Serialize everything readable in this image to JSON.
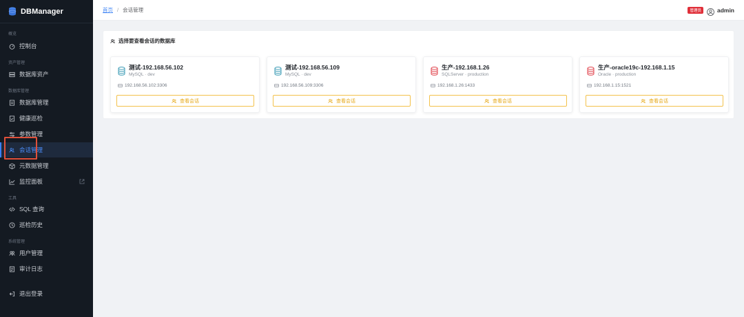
{
  "app": {
    "name": "DBManager"
  },
  "sidebar": {
    "sections": [
      {
        "label": "概览"
      },
      {
        "label": "资产管理"
      },
      {
        "label": "数据库管理"
      },
      {
        "label": "工具"
      },
      {
        "label": "系统管理"
      }
    ],
    "items": [
      {
        "label": "控制台",
        "icon": "dashboard-icon"
      },
      {
        "label": "数据库资产",
        "icon": "server-icon"
      },
      {
        "label": "数据库管理",
        "icon": "database-doc-icon"
      },
      {
        "label": "健康巡检",
        "icon": "check-doc-icon"
      },
      {
        "label": "参数管理",
        "icon": "settings-sliders-icon"
      },
      {
        "label": "会话管理",
        "icon": "users-icon",
        "active": true
      },
      {
        "label": "元数据管理",
        "icon": "cube-icon"
      },
      {
        "label": "监控面板",
        "icon": "line-chart-icon",
        "external": true
      },
      {
        "label": "SQL 查询",
        "icon": "code-icon"
      },
      {
        "label": "巡检历史",
        "icon": "clock-icon"
      },
      {
        "label": "用户管理",
        "icon": "user-group-icon"
      },
      {
        "label": "审计日志",
        "icon": "audit-log-icon"
      }
    ],
    "logout": {
      "label": "退出登录",
      "icon": "logout-icon"
    }
  },
  "header": {
    "breadcrumb": {
      "home": "首页",
      "separator": "/",
      "current": "会话管理"
    },
    "role_badge": "管理员",
    "username": "admin"
  },
  "main": {
    "title": "选择要查看会话的数据库",
    "databases": [
      {
        "name": "测试-192.168.56.102",
        "type": "MySQL",
        "env": "dev",
        "host": "192.168.56.102:3306",
        "color": "#3b9bb5",
        "button": "查看会话"
      },
      {
        "name": "测试-192.168.56.109",
        "type": "MySQL",
        "env": "dev",
        "host": "192.168.56.109:3306",
        "color": "#3b9bb5",
        "button": "查看会话"
      },
      {
        "name": "生产-192.168.1.26",
        "type": "SQLServer",
        "env": "production",
        "host": "192.168.1.26:1433",
        "color": "#e0404a",
        "button": "查看会话"
      },
      {
        "name": "生产-oracle19c-192.168.1.15",
        "type": "Oracle",
        "env": "production",
        "host": "192.168.1.15:1521",
        "color": "#e0404a",
        "button": "查看会话"
      }
    ]
  },
  "colors": {
    "sidebar_bg": "#141a22",
    "accent": "#4a8bf5",
    "warning_button": "#e6a817",
    "highlight": "#e0503a"
  }
}
